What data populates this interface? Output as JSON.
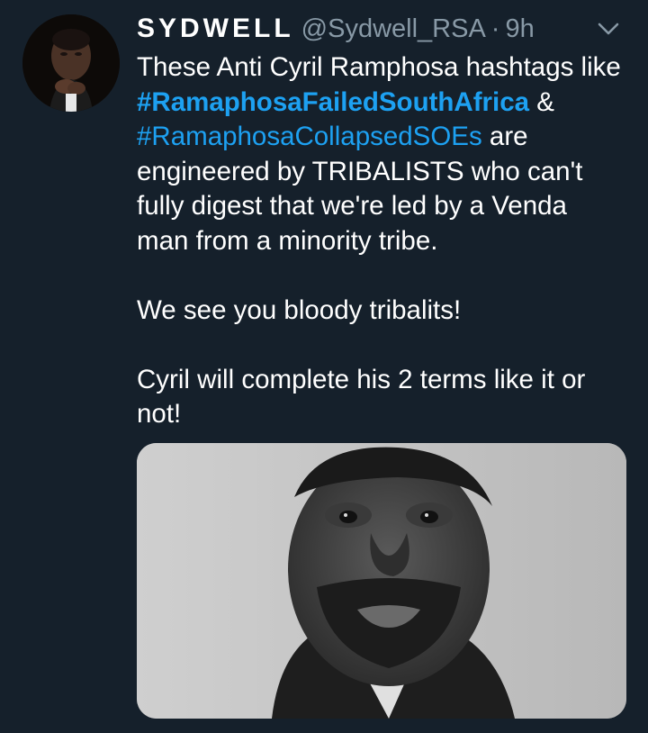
{
  "tweet": {
    "display_name": "SYDWELL",
    "handle": "@Sydwell_RSA",
    "separator": "·",
    "time": "9h",
    "line1": "These Anti Cyril Ramphosa hashtags like",
    "hashtag1": "#RamaphosaFailedSouthAfrica",
    "amp": " &",
    "hashtag2": "#RamaphosaCollapsedSOEs",
    "line3_rest": " are",
    "line4": "engineered by TRIBALISTS who can't",
    "line5": "fully digest that we're led by a Venda",
    "line6": "man from a minority tribe.",
    "para2": "We see you bloody tribalits!",
    "para3_line1": "Cyril will complete his 2 terms like it or",
    "para3_line2": "not!"
  },
  "icons": {
    "caret": "chevron-down-icon"
  },
  "colors": {
    "background": "#15202b",
    "text": "#ffffff",
    "muted": "#8899a6",
    "link": "#1da1f2"
  }
}
